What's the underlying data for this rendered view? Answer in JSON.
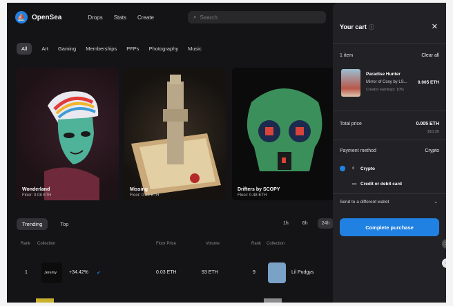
{
  "nav": {
    "brand": "OpenSea",
    "links": [
      "Drops",
      "Stats",
      "Create"
    ],
    "search_placeholder": "Search"
  },
  "categories": [
    "All",
    "Art",
    "Gaming",
    "Memberships",
    "PFPs",
    "Photography",
    "Music"
  ],
  "featured": [
    {
      "title": "Wonderland",
      "floor": "Floor: 0.08 ETH"
    },
    {
      "title": "Missing",
      "floor": "Floor: 0.05 ETH"
    },
    {
      "title": "Drifters by SCOPY",
      "floor": "Floor: 0.48 ETH"
    }
  ],
  "trending": {
    "tabs": [
      "Trending",
      "Top"
    ],
    "ranges": [
      "1h",
      "6h",
      "24h"
    ],
    "columns": [
      "Rank",
      "Collection",
      "Floor Price",
      "Volume",
      "Rank",
      "Collection"
    ],
    "rows": [
      {
        "rank": "1",
        "name": "Jeremy",
        "change": "+34.42%",
        "floor": "0.03 ETH",
        "volume": "93 ETH",
        "rank2": "9",
        "name2": "Lil Pudgys"
      }
    ]
  },
  "cart": {
    "title": "Your cart",
    "items_count": "1 item",
    "clear_all": "Clear all",
    "item": {
      "name": "Paradise Hunter",
      "collection": "Mirror of Cosy by LS...",
      "fee": "Creator earnings: 10%",
      "price": "0.005 ETH"
    },
    "total_label": "Total price",
    "total_value": "0.005 ETH",
    "total_usd": "$10.30",
    "payment_label": "Payment method",
    "payment_type": "Crypto",
    "options": [
      {
        "label": "Crypto",
        "icon": "eth-icon",
        "selected": true
      },
      {
        "label": "Credit or debit card",
        "icon": "card-icon",
        "selected": false
      }
    ],
    "send_label": "Send to a different wallet",
    "complete_label": "Complete purchase"
  }
}
